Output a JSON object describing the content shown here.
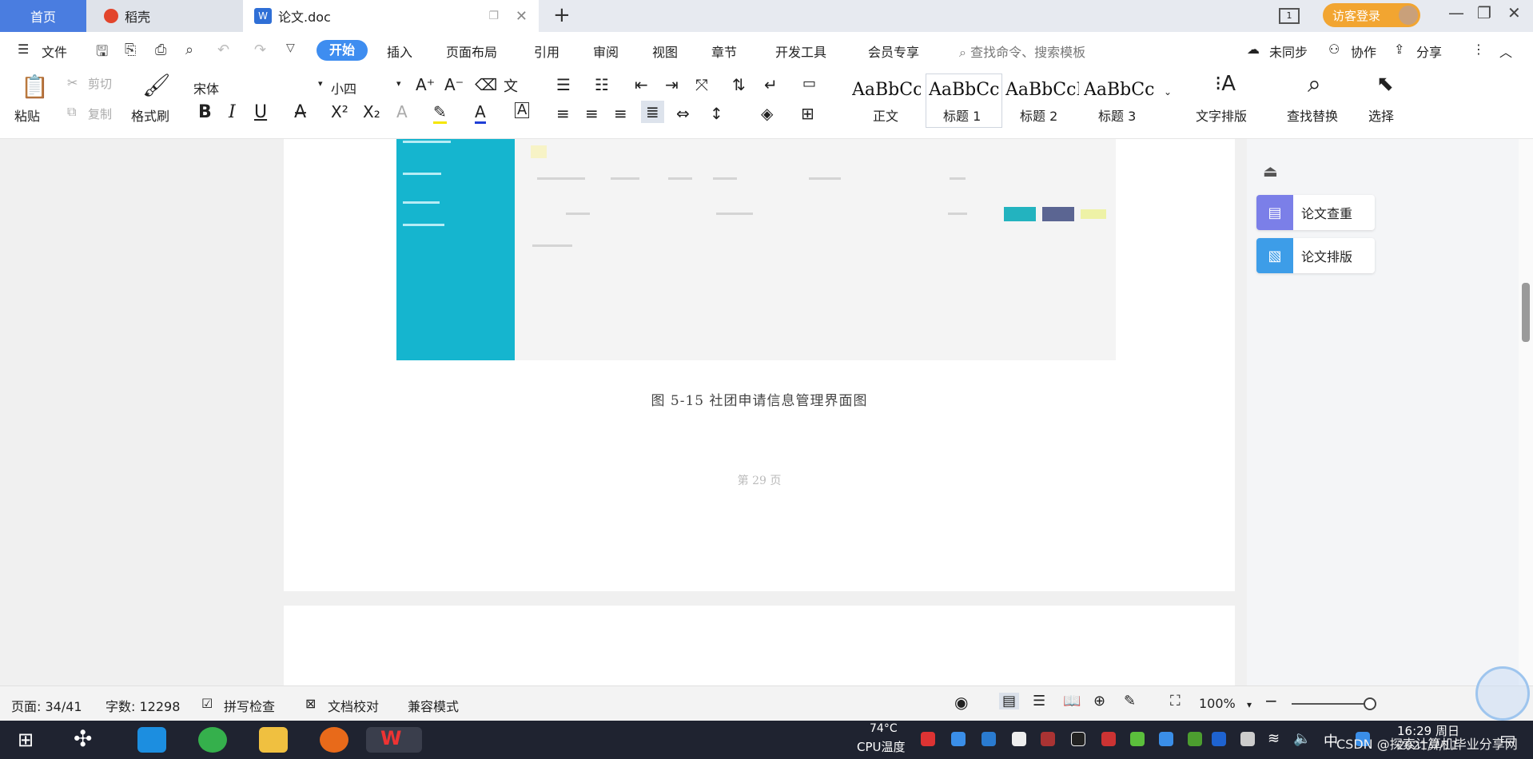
{
  "tabs": {
    "home": "首页",
    "daoke": "稻壳",
    "doc": "论文.doc",
    "add": "+"
  },
  "titlebar": {
    "login": "访客登录",
    "screen_label": "1"
  },
  "menu": {
    "file": "文件",
    "start": "开始",
    "insert": "插入",
    "layout": "页面布局",
    "references": "引用",
    "review": "审阅",
    "view": "视图",
    "chapter": "章节",
    "devtools": "开发工具",
    "member": "会员专享",
    "search": "查找命令、搜索模板",
    "sync": "未同步",
    "collab": "协作",
    "share": "分享"
  },
  "ribbon": {
    "paste": "粘贴",
    "cut": "剪切",
    "copy": "复制",
    "format_painter": "格式刷",
    "font_name": "宋体",
    "font_size": "小四",
    "styles": [
      {
        "preview": "AaBbCcI",
        "label": "正文"
      },
      {
        "preview": "AaBbCc",
        "label": "标题 1"
      },
      {
        "preview": "AaBbCcI",
        "label": "标题 2"
      },
      {
        "preview": "AaBbCc",
        "label": "标题 3"
      }
    ],
    "text_layout": "文字排版",
    "find_replace": "查找替换",
    "select": "选择"
  },
  "document": {
    "caption": "图 5-15 社团申请信息管理界面图",
    "page_number": "第 29 页"
  },
  "right_panel": {
    "items": [
      {
        "label": "论文查重",
        "color": "#7b7fe8"
      },
      {
        "label": "论文排版",
        "color": "#3d9de8"
      }
    ]
  },
  "status": {
    "page": "页面: 34/41",
    "words": "字数: 12298",
    "spell_check": "拼写检查",
    "proofread": "文档校对",
    "compat": "兼容模式",
    "zoom": "100%"
  },
  "taskbar": {
    "cpu_temp": "74°C",
    "cpu_label": "CPU温度",
    "ime": "中",
    "time": "16:29 周日",
    "date": "2021/7/11",
    "watermark": "CSDN @探索计算机毕业分享网"
  }
}
